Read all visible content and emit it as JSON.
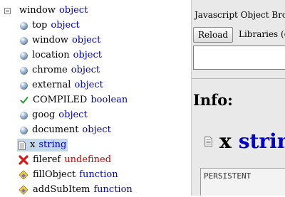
{
  "tree": {
    "root": {
      "name": "window",
      "type": "object"
    },
    "items": [
      {
        "name": "top",
        "type": "object",
        "icon": "ball-icon"
      },
      {
        "name": "window",
        "type": "object",
        "icon": "ball-icon"
      },
      {
        "name": "location",
        "type": "object",
        "icon": "ball-icon"
      },
      {
        "name": "chrome",
        "type": "object",
        "icon": "ball-icon"
      },
      {
        "name": "external",
        "type": "object",
        "icon": "ball-icon"
      },
      {
        "name": "COMPILED",
        "type": "boolean",
        "icon": "checkmark-icon"
      },
      {
        "name": "goog",
        "type": "object",
        "icon": "ball-icon"
      },
      {
        "name": "document",
        "type": "object",
        "icon": "ball-icon"
      },
      {
        "name": "x",
        "type": "string",
        "icon": "document-icon",
        "selected": true
      },
      {
        "name": "fileref",
        "type": "undefined",
        "icon": "red-x-icon"
      },
      {
        "name": "fillObject",
        "type": "function",
        "icon": "function-gem-icon"
      },
      {
        "name": "addSubItem",
        "type": "function",
        "icon": "function-gem-icon"
      }
    ]
  },
  "panel": {
    "title": "Javascript Object Bro",
    "reload_label": "Reload",
    "libraries_label": "Libraries (o",
    "info_heading": "Info:",
    "selected_name": "x",
    "selected_type": "string",
    "persist_label": "PERSISTENT"
  },
  "colors": {
    "type_text": "#0000c8",
    "undefined_text": "#d00000",
    "selection": "#c4d8ec",
    "panel_bg": "#e9e9e9"
  }
}
